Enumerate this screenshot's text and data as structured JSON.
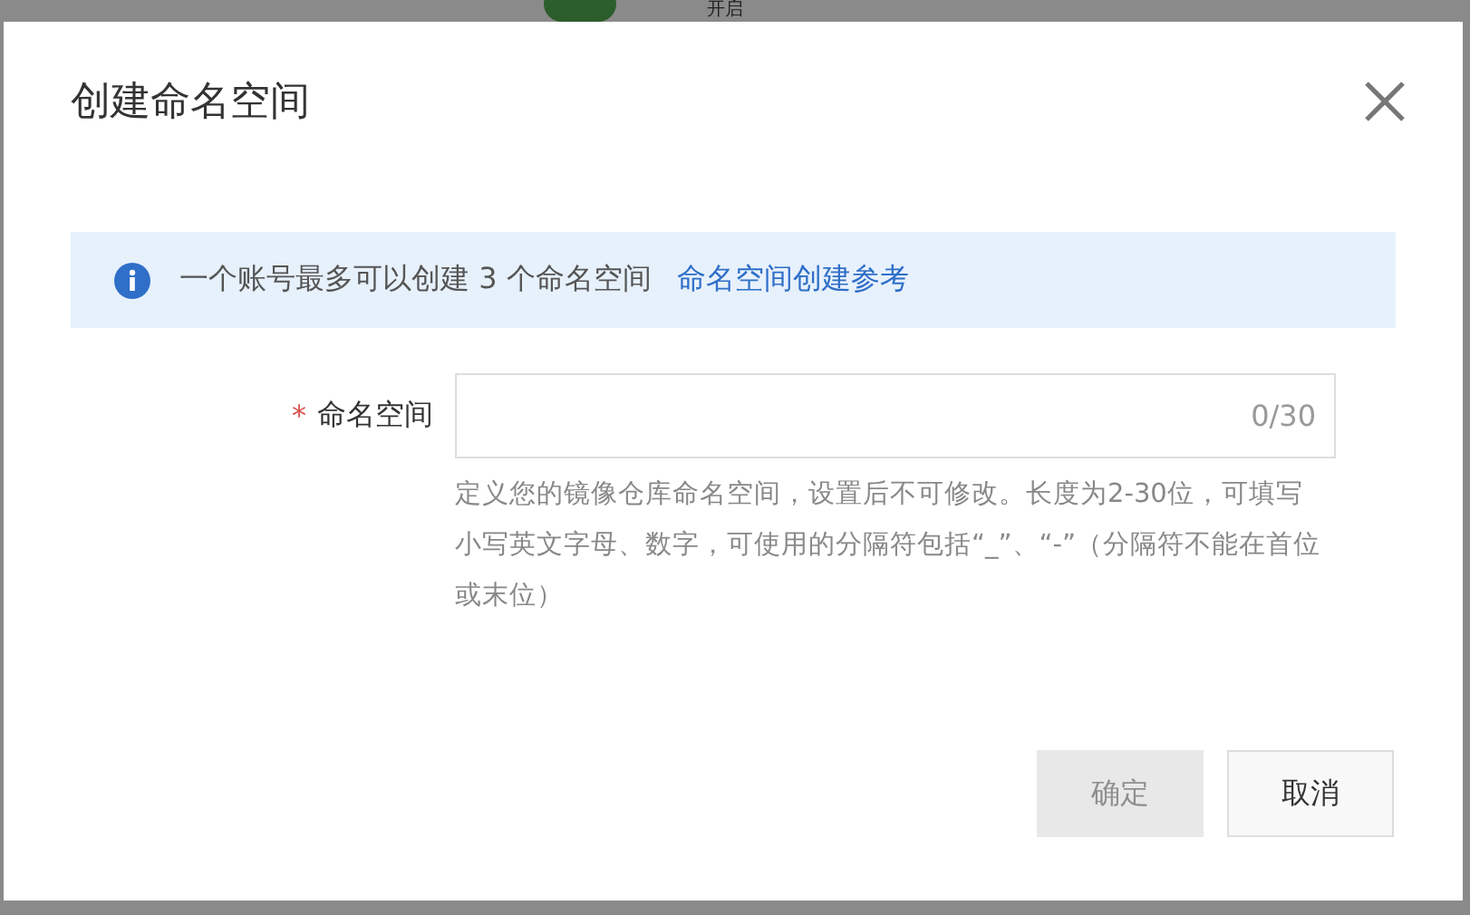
{
  "background": {
    "toggle_on": true,
    "toggle_label": "开启"
  },
  "dialog": {
    "title": "创建命名空间",
    "notice": {
      "text": "一个账号最多可以创建 3 个命名空间",
      "link": "命名空间创建参考"
    },
    "field": {
      "label": "命名空间",
      "required_mark": "*",
      "counter": "0/30",
      "help": "定义您的镜像仓库命名空间，设置后不可修改。长度为2-30位，可填写小写英文字母、数字，可使用的分隔符包括“_”、“-”（分隔符不能在首位或末位）"
    },
    "buttons": [
      {
        "label": "确定",
        "kind": "primary",
        "disabled": true
      },
      {
        "label": "取消",
        "kind": "default",
        "disabled": false
      }
    ]
  }
}
